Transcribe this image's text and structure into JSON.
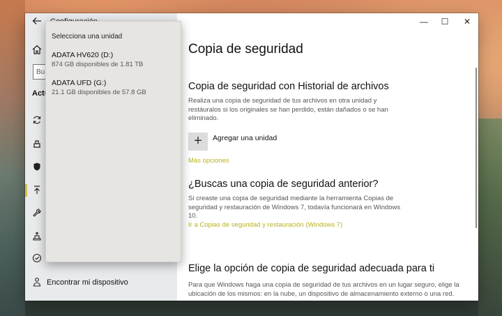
{
  "window": {
    "sidebar_title": "Configuración",
    "search_placeholder": "Bu",
    "section_label": "Actu",
    "find_device": "Encontrar mi dispositivo",
    "controls": {
      "minimize": "—",
      "maximize": "☐",
      "close": "✕"
    }
  },
  "main": {
    "page_title": "Copia de seguridad",
    "history_heading": "Copia de seguridad con Historial de archivos",
    "history_desc": "Realiza una copia de seguridad de tus archivos en otra unidad y restáuralos si los originales se han perdido, están dañados o se han eliminado.",
    "add_drive_icon": "+",
    "add_drive_label": "Agregar una unidad",
    "more_options": "Más opciones",
    "older_heading": "¿Buscas una copia de seguridad anterior?",
    "older_desc": "Si creaste una copia de seguridad mediante la herramienta Copias de seguridad y restauración de Windows 7, todavía funcionará en Windows 10.",
    "older_link": "Ir a Copias de seguridad y restauración (Windows 7)",
    "choose_heading": "Elige la opción de copia de seguridad adecuada para ti",
    "choose_desc": "Para que Windows haga una copia de seguridad de tus archivos en un lugar seguro, elige la ubicación de los mismos: en la nube, un dispositivo de almacenamiento externo o una red."
  },
  "popup": {
    "title": "Selecciona una unidad",
    "drives": [
      {
        "name": "ADATA HV620 (D:)",
        "space": "874 GB disponibles de 1.81 TB"
      },
      {
        "name": "ADATA UFD (G:)",
        "space": "21.1 GB disponibles de 57.8 GB"
      }
    ]
  },
  "icons": {
    "back": "back-arrow-icon",
    "home": "home-icon",
    "sync": "sync-icon",
    "delivery": "delivery-optimization-icon",
    "security": "shield-icon",
    "backup": "backup-arrow-up-icon",
    "troubleshoot": "wrench-icon",
    "recovery": "recovery-icon",
    "activation": "activation-check-icon",
    "find_device": "person-location-icon"
  },
  "colors": {
    "accent": "#b8b21e",
    "active_bar": "#d3c04a"
  }
}
